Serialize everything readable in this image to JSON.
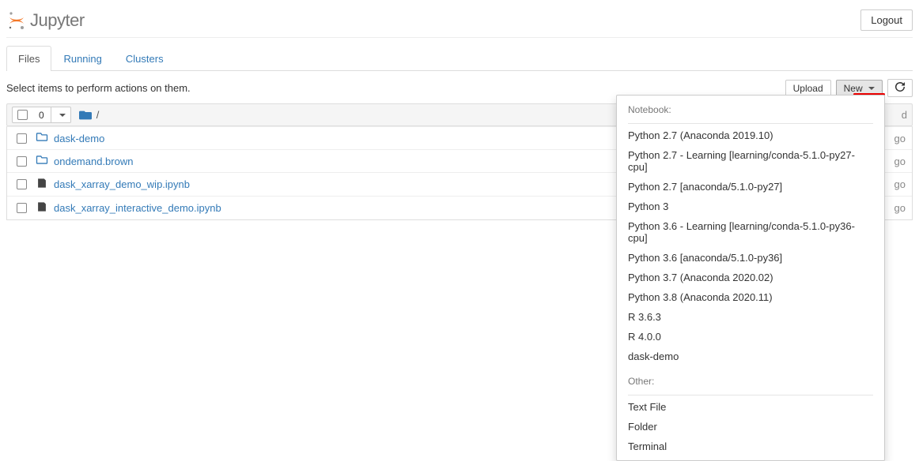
{
  "header": {
    "brand": "Jupyter",
    "logout_label": "Logout"
  },
  "tabs": [
    {
      "id": "files",
      "label": "Files",
      "active": true
    },
    {
      "id": "running",
      "label": "Running",
      "active": false
    },
    {
      "id": "clusters",
      "label": "Clusters",
      "active": false
    }
  ],
  "hint": "Select items to perform actions on them.",
  "toolbar": {
    "upload_label": "Upload",
    "new_label": "New",
    "selected_count": "0"
  },
  "breadcrumbs": {
    "root_sep": "/"
  },
  "files": [
    {
      "type": "folder",
      "name": "dask-demo",
      "meta_tail": "go"
    },
    {
      "type": "folder",
      "name": "ondemand.brown",
      "meta_tail": "go"
    },
    {
      "type": "notebook",
      "name": "dask_xarray_demo_wip.ipynb",
      "meta_tail": "go"
    },
    {
      "type": "notebook",
      "name": "dask_xarray_interactive_demo.ipynb",
      "meta_tail": "go"
    }
  ],
  "new_menu": {
    "notebook_heading": "Notebook:",
    "other_heading": "Other:",
    "notebook_items": [
      "Python 2.7 (Anaconda 2019.10)",
      "Python 2.7 - Learning [learning/conda-5.1.0-py27-cpu]",
      "Python 2.7 [anaconda/5.1.0-py27]",
      "Python 3",
      "Python 3.6 - Learning [learning/conda-5.1.0-py36-cpu]",
      "Python 3.6 [anaconda/5.1.0-py36]",
      "Python 3.7 (Anaconda 2020.02)",
      "Python 3.8 (Anaconda 2020.11)",
      "R 3.6.3",
      "R 4.0.0",
      "dask-demo"
    ],
    "other_items": [
      "Text File",
      "Folder",
      "Terminal"
    ]
  },
  "column_header_tail": "d"
}
